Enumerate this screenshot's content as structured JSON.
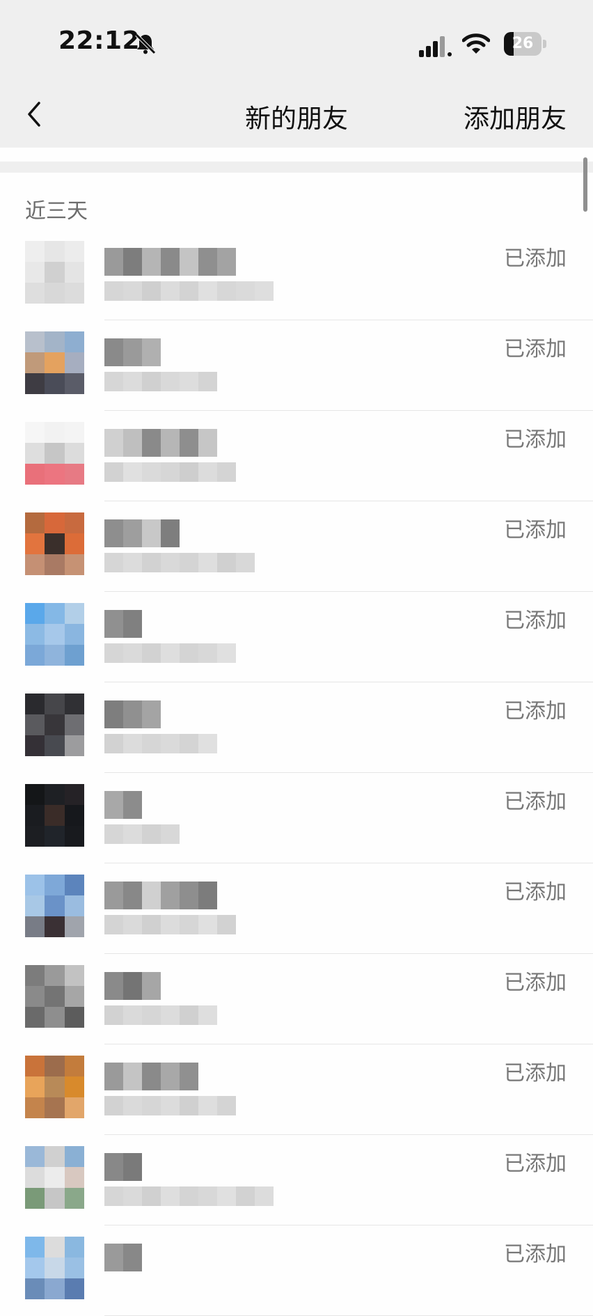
{
  "status_bar": {
    "time": "22:12",
    "battery": "26"
  },
  "nav": {
    "title": "新的朋友",
    "action": "添加朋友"
  },
  "section": {
    "label": "近三天"
  },
  "contacts": [
    {
      "status": "已添加",
      "avatar": [
        "#eeeeee",
        "#e6e6e6",
        "#ececec",
        "#e8e8e8",
        "#d0d0d0",
        "#e4e4e4",
        "#dedede",
        "#d8d8d8",
        "#dcdcdc"
      ],
      "name_blocks": [
        "#9a9a9a",
        "#7d7d7d",
        "#b5b5b5",
        "#8a8a8a",
        "#c4c4c4",
        "#8f8f8f",
        "#a3a3a3"
      ],
      "sub_blocks": [
        "#d6d6d6",
        "#d9d9d9",
        "#cfcfcf",
        "#dcdcdc",
        "#d3d3d3",
        "#e0e0e0",
        "#d7d7d7",
        "#dadada",
        "#dedede"
      ]
    },
    {
      "status": "已添加",
      "avatar": [
        "#b8c0cc",
        "#a3b4c8",
        "#8eaed0",
        "#c09a7a",
        "#e4a25f",
        "#a6aec0",
        "#3e3c43",
        "#4a4c58",
        "#5a5c68"
      ],
      "name_blocks": [
        "#8a8a8a",
        "#9a9a9a",
        "#b0b0b0"
      ],
      "sub_blocks": [
        "#d6d6d6",
        "#dcdcdc",
        "#d0d0d0",
        "#d9d9d9",
        "#dddddd",
        "#d4d4d4"
      ]
    },
    {
      "status": "已添加",
      "avatar": [
        "#f6f6f6",
        "#f2f2f2",
        "#f4f4f4",
        "#dedede",
        "#c6c6c6",
        "#dcdcdc",
        "#e9707a",
        "#ec7580",
        "#e77a84"
      ],
      "name_blocks": [
        "#d0d0d0",
        "#bfbfbf",
        "#8a8a8a",
        "#b6b6b6",
        "#8e8e8e",
        "#c6c6c6"
      ],
      "sub_blocks": [
        "#d2d2d2",
        "#e0e0e0",
        "#dadada",
        "#d6d6d6",
        "#cecece",
        "#dcdcdc",
        "#d4d4d4"
      ]
    },
    {
      "status": "已添加",
      "avatar": [
        "#b46a3e",
        "#d7683a",
        "#c86a3f",
        "#e2743e",
        "#3a2f2b",
        "#dc6c38",
        "#c59074",
        "#a97a64",
        "#c69274"
      ],
      "name_blocks": [
        "#8e8e8e",
        "#9e9e9e",
        "#c8c8c8",
        "#7e7e7e"
      ],
      "sub_blocks": [
        "#d6d6d6",
        "#dcdcdc",
        "#d2d2d2",
        "#d9d9d9",
        "#d4d4d4",
        "#dedede",
        "#d0d0d0",
        "#d8d8d8"
      ]
    },
    {
      "status": "已添加",
      "avatar": [
        "#5aa8ea",
        "#84b8e6",
        "#b2cfe8",
        "#8cbae4",
        "#a6c8ea",
        "#8ab6e0",
        "#7ba8d8",
        "#8fb4dc",
        "#6ea0d0"
      ],
      "name_blocks": [
        "#909090",
        "#808080"
      ],
      "sub_blocks": [
        "#d6d6d6",
        "#dadada",
        "#d2d2d2",
        "#dedede",
        "#d4d4d4",
        "#d8d8d8",
        "#e0e0e0"
      ]
    },
    {
      "status": "已添加",
      "avatar": [
        "#2a2a2e",
        "#46464a",
        "#303034",
        "#5a5a5e",
        "#38363a",
        "#6e6e72",
        "#343036",
        "#484a50",
        "#9c9c9e"
      ],
      "name_blocks": [
        "#7e7e7e",
        "#909090",
        "#a4a4a4"
      ],
      "sub_blocks": [
        "#d2d2d2",
        "#dcdcdc",
        "#d6d6d6",
        "#dadada",
        "#d4d4d4",
        "#e0e0e0"
      ]
    },
    {
      "status": "已添加",
      "avatar": [
        "#141618",
        "#1e2024",
        "#252226",
        "#1a1c20",
        "#3a2c28",
        "#16181c",
        "#1c1e22",
        "#20242a",
        "#181a1e"
      ],
      "name_blocks": [
        "#a8a8a8",
        "#8c8c8c"
      ],
      "sub_blocks": [
        "#d6d6d6",
        "#dcdcdc",
        "#d2d2d2",
        "#d8d8d8"
      ]
    },
    {
      "status": "已添加",
      "avatar": [
        "#9cc2e8",
        "#7ea8d8",
        "#5c84bc",
        "#a8c8e6",
        "#6a92c8",
        "#9abce0",
        "#787c86",
        "#3a3034",
        "#a0a4ac"
      ],
      "name_blocks": [
        "#9a9a9a",
        "#888888",
        "#d0d0d0",
        "#a0a0a0",
        "#8e8e8e",
        "#7c7c7c"
      ],
      "sub_blocks": [
        "#d4d4d4",
        "#dadada",
        "#d0d0d0",
        "#dcdcdc",
        "#d6d6d6",
        "#e0e0e0",
        "#d2d2d2"
      ]
    },
    {
      "status": "已添加",
      "avatar": [
        "#7c7c7c",
        "#9a9a9a",
        "#c2c2c2",
        "#8a8a8a",
        "#747474",
        "#a6a6a6",
        "#6a6a6a",
        "#8e8e8e",
        "#5c5c5c"
      ],
      "name_blocks": [
        "#8a8a8a",
        "#747474",
        "#a6a6a6"
      ],
      "sub_blocks": [
        "#d2d2d2",
        "#dadada",
        "#d6d6d6",
        "#dcdcdc",
        "#d0d0d0",
        "#dedede"
      ]
    },
    {
      "status": "已添加",
      "avatar": [
        "#c9733a",
        "#9c6c4c",
        "#c37c3c",
        "#e8a45a",
        "#b88a58",
        "#d88a2c",
        "#c4844c",
        "#a67450",
        "#e2a66a"
      ],
      "name_blocks": [
        "#9a9a9a",
        "#c4c4c4",
        "#8a8a8a",
        "#a8a8a8",
        "#909090"
      ],
      "sub_blocks": [
        "#d2d2d2",
        "#dadada",
        "#d6d6d6",
        "#dcdcdc",
        "#d0d0d0",
        "#dedede",
        "#d4d4d4"
      ]
    },
    {
      "status": "已添加",
      "avatar": [
        "#9ab8d8",
        "#d0d0d0",
        "#8ab0d4",
        "#dcdcdc",
        "#ececec",
        "#d8c8c0",
        "#7a9a78",
        "#c6c6c6",
        "#8aa88a"
      ],
      "name_blocks": [
        "#888888",
        "#7a7a7a"
      ],
      "sub_blocks": [
        "#d6d6d6",
        "#dadada",
        "#d0d0d0",
        "#dedede",
        "#d4d4d4",
        "#d8d8d8",
        "#e0e0e0",
        "#d2d2d2",
        "#dcdcdc"
      ]
    },
    {
      "status": "已添加",
      "avatar": [
        "#7eb8ea",
        "#dcdcdc",
        "#8ab8e0",
        "#a4c8ec",
        "#c8d8e8",
        "#9ac0e4",
        "#6a8cb8",
        "#8aa8d0",
        "#5a7cb0"
      ],
      "name_blocks": [
        "#9a9a9a",
        "#888888"
      ],
      "sub_blocks": []
    }
  ]
}
